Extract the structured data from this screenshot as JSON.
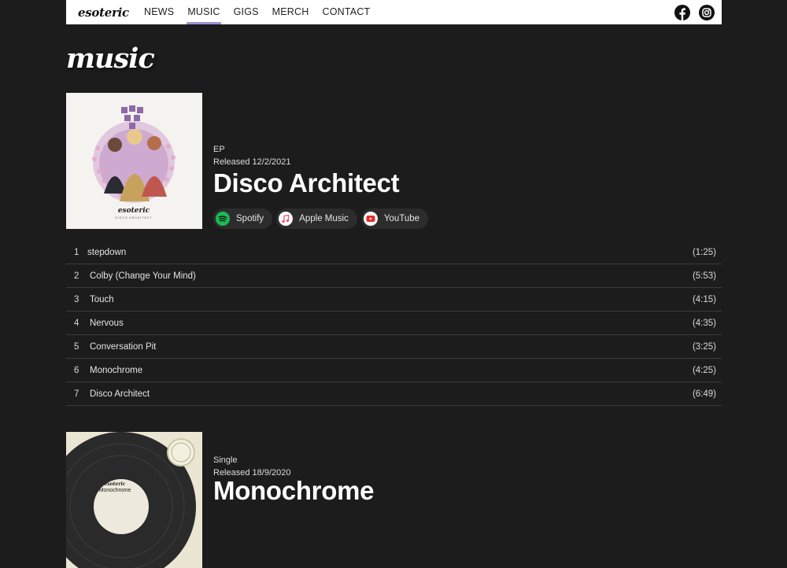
{
  "nav": {
    "logo": "esoteric",
    "items": [
      {
        "label": "NEWS",
        "active": false
      },
      {
        "label": "MUSIC",
        "active": true
      },
      {
        "label": "GIGS",
        "active": false
      },
      {
        "label": "MERCH",
        "active": false
      },
      {
        "label": "CONTACT",
        "active": false
      }
    ],
    "social": [
      {
        "icon": "facebook-icon"
      },
      {
        "icon": "instagram-icon"
      }
    ]
  },
  "page_title": "music",
  "releases": [
    {
      "type": "EP",
      "released": "Released 12/2/2021",
      "title": "Disco Architect",
      "cover_text": "esoteric",
      "cover_subtext": "DISCO ARCHITECT",
      "links": [
        {
          "label": "Spotify",
          "icon": "spotify-icon",
          "color": "#1db954"
        },
        {
          "label": "Apple Music",
          "icon": "apple-music-icon",
          "color": "#f4506e"
        },
        {
          "label": "YouTube",
          "icon": "youtube-icon",
          "color": "#e52d27"
        }
      ],
      "tracks": [
        {
          "num": "1",
          "name": "stepdown",
          "duration": "(1:25)"
        },
        {
          "num": "2",
          "name": "Colby (Change Your Mind)",
          "duration": "(5:53)"
        },
        {
          "num": "3",
          "name": "Touch",
          "duration": "(4:15)"
        },
        {
          "num": "4",
          "name": "Nervous",
          "duration": "(4:35)"
        },
        {
          "num": "5",
          "name": "Conversation Pit",
          "duration": "(3:25)"
        },
        {
          "num": "6",
          "name": "Monochrome",
          "duration": "(4:25)"
        },
        {
          "num": "7",
          "name": "Disco Architect",
          "duration": "(6:49)"
        }
      ]
    },
    {
      "type": "Single",
      "released": "Released 18/9/2020",
      "title": "Monochrome",
      "cover_text": "esoteric",
      "cover_subtext": "Monochrome"
    }
  ],
  "colors": {
    "background": "#1c1c1d",
    "nav_active_underline": "#9f93d4"
  }
}
